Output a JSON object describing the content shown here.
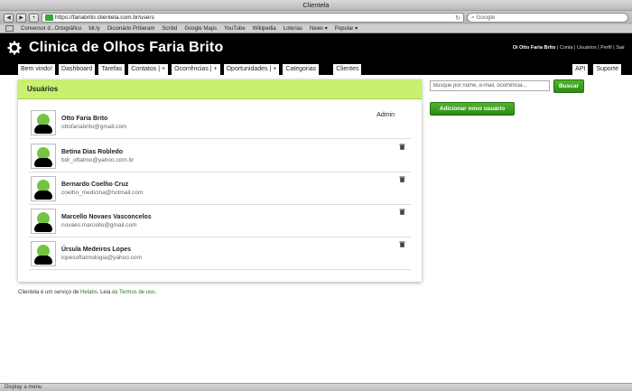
{
  "window": {
    "title": "Clientela"
  },
  "browser": {
    "url": "https://fariabrito.clientela.com.br/users",
    "search_placeholder": "Google",
    "bookmarks": [
      "Conversor d...Ortográfico",
      "bit.ly",
      "Dicionário Priberam",
      "Scribd",
      "Google Maps",
      "YouTube",
      "Wikipedia",
      "Loterias",
      "News ▾",
      "Popular ▾"
    ]
  },
  "header": {
    "title": "Clinica de Olhos Faria Brito",
    "user_greeting": "Oi Otto Faria Brito",
    "links": "| Conta | Usuários | Perfil | Sair"
  },
  "tabs": [
    {
      "label": "Bem vindo!"
    },
    {
      "label": "Dashboard"
    },
    {
      "label": "Tarefas"
    },
    {
      "label": "Contatos | +"
    },
    {
      "label": "Ocorrências | +"
    },
    {
      "label": "Oportunidades | +"
    },
    {
      "label": "Categorias"
    },
    {
      "label": "Clientes"
    }
  ],
  "tabs_right": [
    {
      "label": "API"
    },
    {
      "label": "Suporte"
    }
  ],
  "panel": {
    "title": "Usuários"
  },
  "users": [
    {
      "name": "Otto Faria Brito",
      "email": "ottofariabrito@gmail.com",
      "role": "Admin"
    },
    {
      "name": "Betina Dias Robledo",
      "email": "bdr_oftalmo@yahoo.com.br",
      "role": ""
    },
    {
      "name": "Bernardo Coelho Cruz",
      "email": "coelho_medicina@hotmail.com",
      "role": ""
    },
    {
      "name": "Marcello Novaes Vasconcelos",
      "email": "novaes.marcello@gmail.com",
      "role": ""
    },
    {
      "name": "Úrsula Medeiros Lopes",
      "email": "lopesoftalmologia@yahoo.com",
      "role": ""
    }
  ],
  "sidebar": {
    "search_value": "Busque por nome, e-mail, ocorrência...",
    "search_button": "Buscar",
    "add_button": "Adicionar novo usuário"
  },
  "footer": {
    "prefix": "Clientela é um serviço de",
    "company": "Helabs",
    "middle": ". Leia os",
    "terms": "Termos de uso",
    "suffix": "."
  },
  "statusbar": {
    "text": "Display a menu"
  },
  "colors": {
    "accent": "#c9f06f",
    "button": "#3aa020"
  }
}
